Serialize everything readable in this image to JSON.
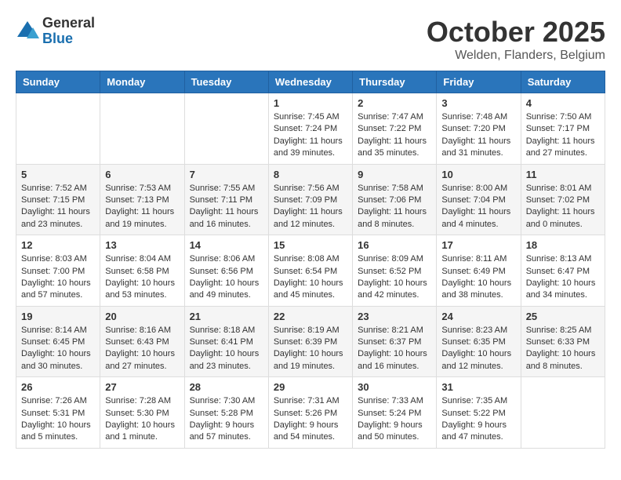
{
  "logo": {
    "general": "General",
    "blue": "Blue"
  },
  "title": "October 2025",
  "location": "Welden, Flanders, Belgium",
  "days_of_week": [
    "Sunday",
    "Monday",
    "Tuesday",
    "Wednesday",
    "Thursday",
    "Friday",
    "Saturday"
  ],
  "weeks": [
    [
      {
        "day": "",
        "info": ""
      },
      {
        "day": "",
        "info": ""
      },
      {
        "day": "",
        "info": ""
      },
      {
        "day": "1",
        "info": "Sunrise: 7:45 AM\nSunset: 7:24 PM\nDaylight: 11 hours\nand 39 minutes."
      },
      {
        "day": "2",
        "info": "Sunrise: 7:47 AM\nSunset: 7:22 PM\nDaylight: 11 hours\nand 35 minutes."
      },
      {
        "day": "3",
        "info": "Sunrise: 7:48 AM\nSunset: 7:20 PM\nDaylight: 11 hours\nand 31 minutes."
      },
      {
        "day": "4",
        "info": "Sunrise: 7:50 AM\nSunset: 7:17 PM\nDaylight: 11 hours\nand 27 minutes."
      }
    ],
    [
      {
        "day": "5",
        "info": "Sunrise: 7:52 AM\nSunset: 7:15 PM\nDaylight: 11 hours\nand 23 minutes."
      },
      {
        "day": "6",
        "info": "Sunrise: 7:53 AM\nSunset: 7:13 PM\nDaylight: 11 hours\nand 19 minutes."
      },
      {
        "day": "7",
        "info": "Sunrise: 7:55 AM\nSunset: 7:11 PM\nDaylight: 11 hours\nand 16 minutes."
      },
      {
        "day": "8",
        "info": "Sunrise: 7:56 AM\nSunset: 7:09 PM\nDaylight: 11 hours\nand 12 minutes."
      },
      {
        "day": "9",
        "info": "Sunrise: 7:58 AM\nSunset: 7:06 PM\nDaylight: 11 hours\nand 8 minutes."
      },
      {
        "day": "10",
        "info": "Sunrise: 8:00 AM\nSunset: 7:04 PM\nDaylight: 11 hours\nand 4 minutes."
      },
      {
        "day": "11",
        "info": "Sunrise: 8:01 AM\nSunset: 7:02 PM\nDaylight: 11 hours\nand 0 minutes."
      }
    ],
    [
      {
        "day": "12",
        "info": "Sunrise: 8:03 AM\nSunset: 7:00 PM\nDaylight: 10 hours\nand 57 minutes."
      },
      {
        "day": "13",
        "info": "Sunrise: 8:04 AM\nSunset: 6:58 PM\nDaylight: 10 hours\nand 53 minutes."
      },
      {
        "day": "14",
        "info": "Sunrise: 8:06 AM\nSunset: 6:56 PM\nDaylight: 10 hours\nand 49 minutes."
      },
      {
        "day": "15",
        "info": "Sunrise: 8:08 AM\nSunset: 6:54 PM\nDaylight: 10 hours\nand 45 minutes."
      },
      {
        "day": "16",
        "info": "Sunrise: 8:09 AM\nSunset: 6:52 PM\nDaylight: 10 hours\nand 42 minutes."
      },
      {
        "day": "17",
        "info": "Sunrise: 8:11 AM\nSunset: 6:49 PM\nDaylight: 10 hours\nand 38 minutes."
      },
      {
        "day": "18",
        "info": "Sunrise: 8:13 AM\nSunset: 6:47 PM\nDaylight: 10 hours\nand 34 minutes."
      }
    ],
    [
      {
        "day": "19",
        "info": "Sunrise: 8:14 AM\nSunset: 6:45 PM\nDaylight: 10 hours\nand 30 minutes."
      },
      {
        "day": "20",
        "info": "Sunrise: 8:16 AM\nSunset: 6:43 PM\nDaylight: 10 hours\nand 27 minutes."
      },
      {
        "day": "21",
        "info": "Sunrise: 8:18 AM\nSunset: 6:41 PM\nDaylight: 10 hours\nand 23 minutes."
      },
      {
        "day": "22",
        "info": "Sunrise: 8:19 AM\nSunset: 6:39 PM\nDaylight: 10 hours\nand 19 minutes."
      },
      {
        "day": "23",
        "info": "Sunrise: 8:21 AM\nSunset: 6:37 PM\nDaylight: 10 hours\nand 16 minutes."
      },
      {
        "day": "24",
        "info": "Sunrise: 8:23 AM\nSunset: 6:35 PM\nDaylight: 10 hours\nand 12 minutes."
      },
      {
        "day": "25",
        "info": "Sunrise: 8:25 AM\nSunset: 6:33 PM\nDaylight: 10 hours\nand 8 minutes."
      }
    ],
    [
      {
        "day": "26",
        "info": "Sunrise: 7:26 AM\nSunset: 5:31 PM\nDaylight: 10 hours\nand 5 minutes."
      },
      {
        "day": "27",
        "info": "Sunrise: 7:28 AM\nSunset: 5:30 PM\nDaylight: 10 hours\nand 1 minute."
      },
      {
        "day": "28",
        "info": "Sunrise: 7:30 AM\nSunset: 5:28 PM\nDaylight: 9 hours\nand 57 minutes."
      },
      {
        "day": "29",
        "info": "Sunrise: 7:31 AM\nSunset: 5:26 PM\nDaylight: 9 hours\nand 54 minutes."
      },
      {
        "day": "30",
        "info": "Sunrise: 7:33 AM\nSunset: 5:24 PM\nDaylight: 9 hours\nand 50 minutes."
      },
      {
        "day": "31",
        "info": "Sunrise: 7:35 AM\nSunset: 5:22 PM\nDaylight: 9 hours\nand 47 minutes."
      },
      {
        "day": "",
        "info": ""
      }
    ]
  ]
}
